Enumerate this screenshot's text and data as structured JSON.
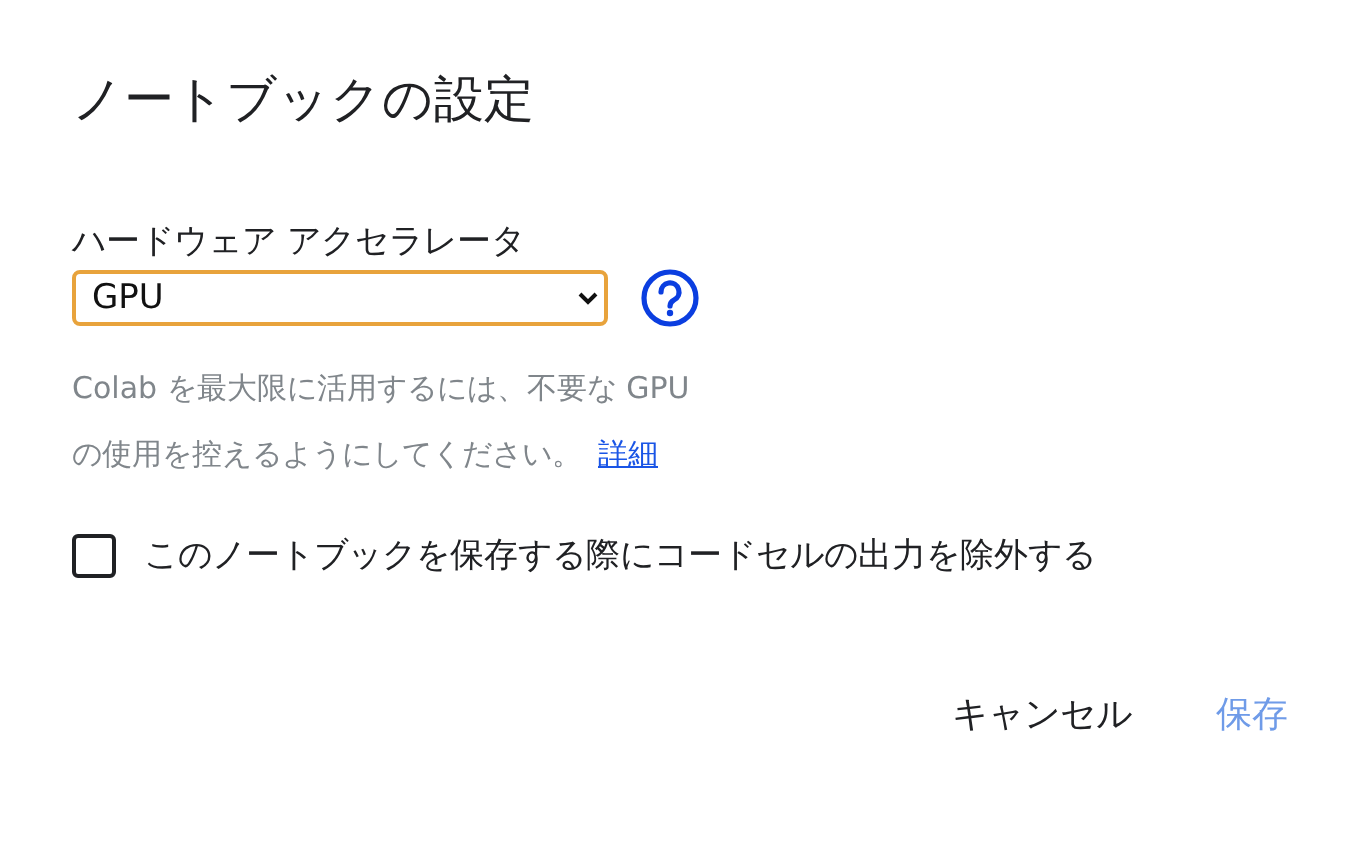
{
  "dialog": {
    "title": "ノートブックの設定",
    "accelerator": {
      "label": "ハードウェア アクセラレータ",
      "value": "GPU",
      "focused": true
    },
    "help": {
      "kind": "question"
    },
    "description": {
      "text": "Colab を最大限に活用するには、不要な GPU の使用を控えるようにしてください。",
      "link": "詳細"
    },
    "omit_output": {
      "label": "このノートブックを保存する際にコードセルの出力を除外する",
      "checked": false
    },
    "buttons": [
      {
        "label": "キャンセル",
        "kind": "secondary"
      },
      {
        "label": "保存",
        "kind": "primary"
      }
    ]
  }
}
